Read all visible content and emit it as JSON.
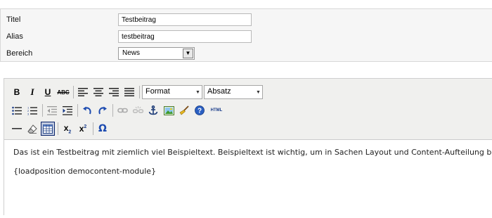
{
  "form": {
    "title_label": "Titel",
    "title_value": "Testbeitrag",
    "alias_label": "Alias",
    "alias_value": "testbeitrag",
    "section_label": "Bereich",
    "section_value": "News"
  },
  "toolbar": {
    "format_select": "Format",
    "paragraph_select": "Absatz",
    "html_button": "HTML"
  },
  "content": {
    "paragraph_1": "Das ist ein Testbeitrag mit ziemlich viel Beispieltext. Beispieltext ist wichtig, um in Sachen Layout und Content-Aufteilung besse",
    "paragraph_2": "{loadposition democontent-module}"
  }
}
